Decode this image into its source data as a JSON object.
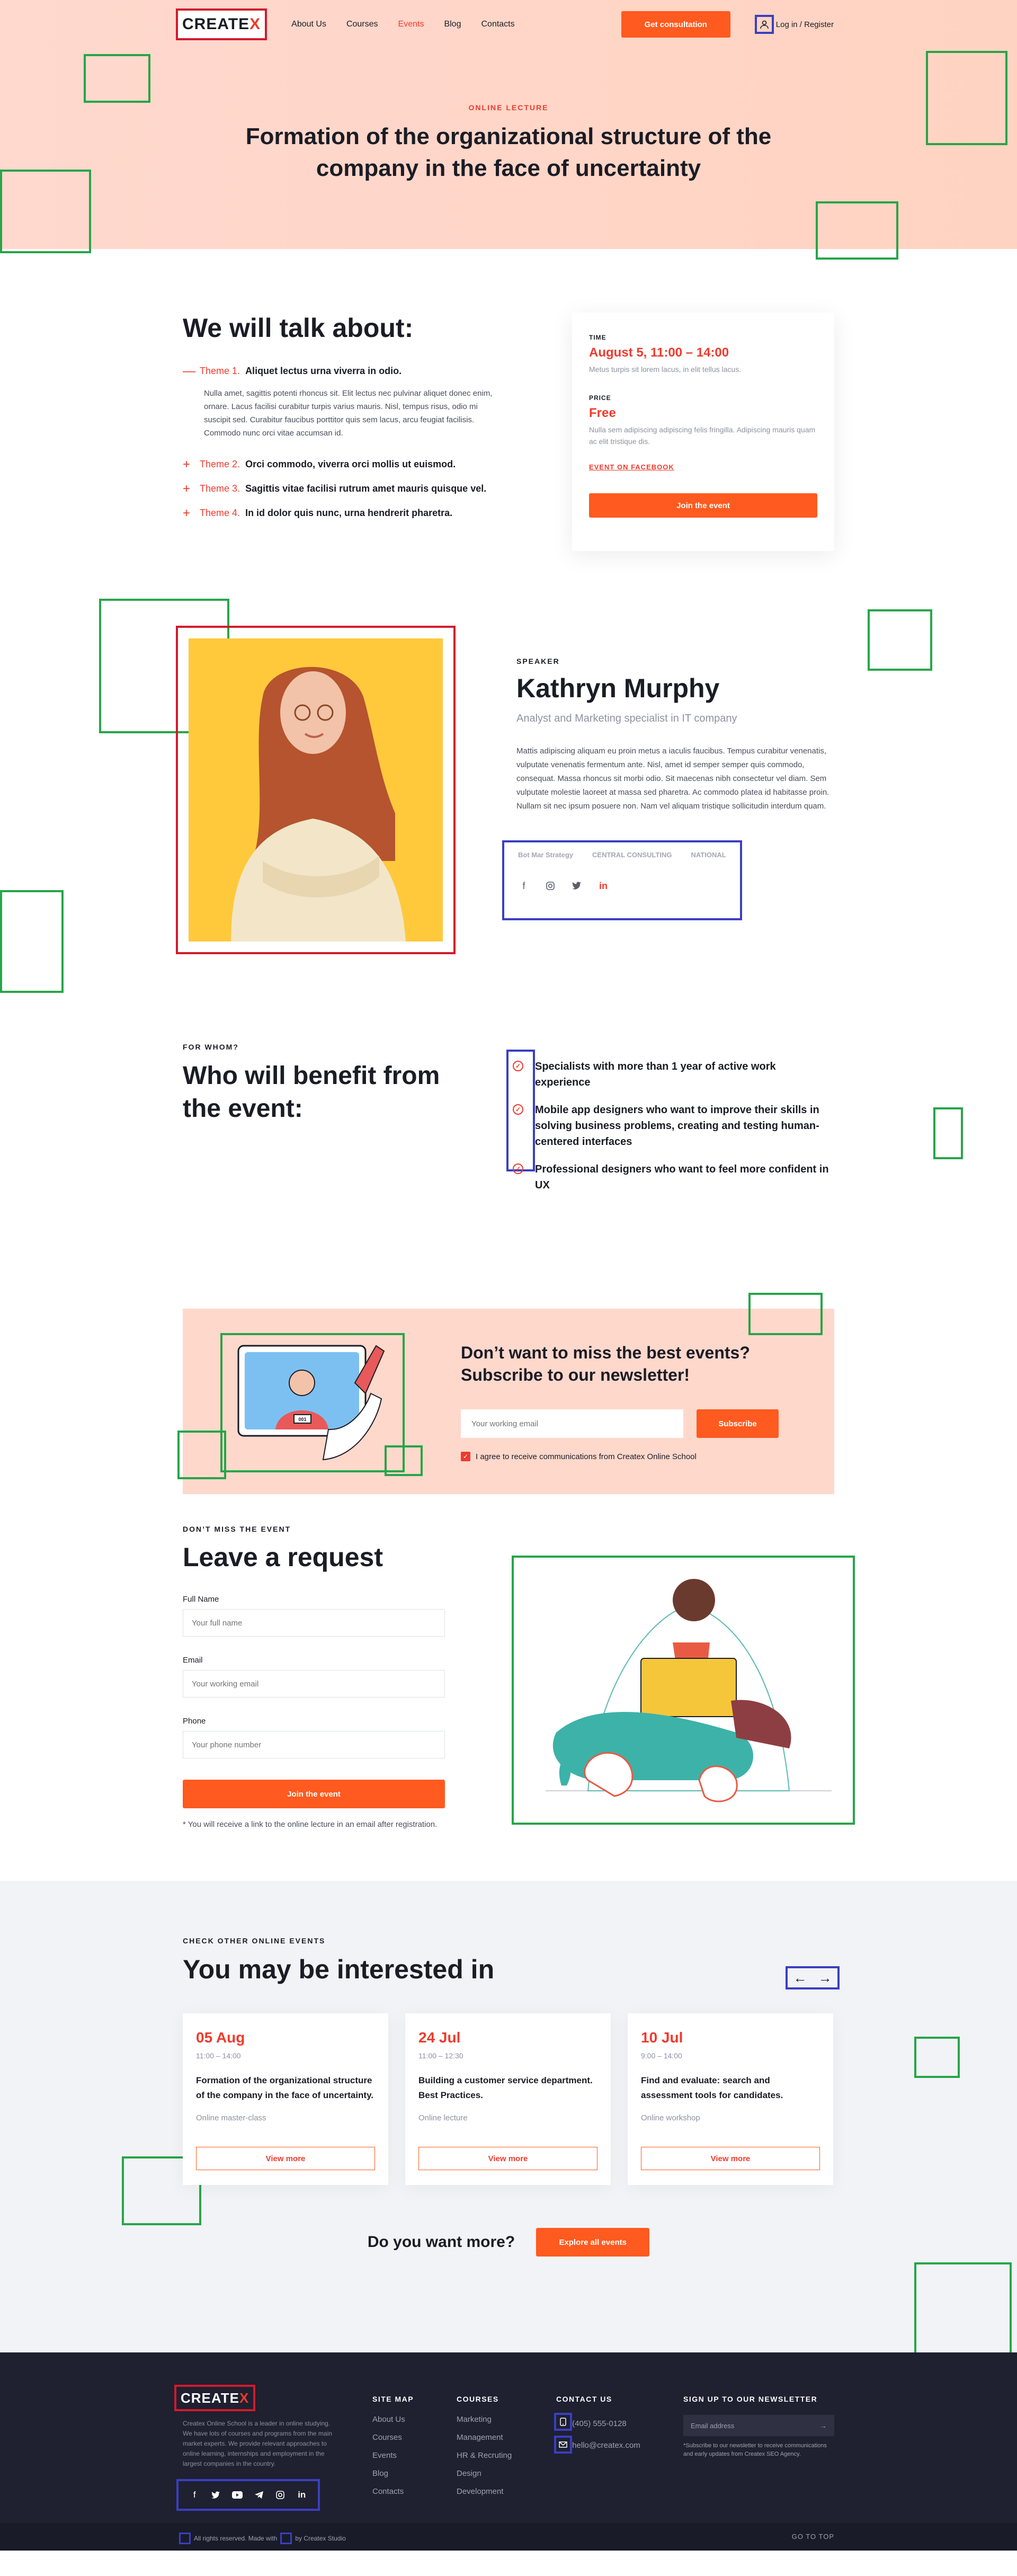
{
  "brand": {
    "logo_main": "CREATE",
    "logo_x": "X"
  },
  "nav": {
    "items": [
      "About Us",
      "Courses",
      "Events",
      "Blog",
      "Contacts"
    ],
    "active_item": "Events",
    "cta": "Get consultation",
    "login": "Log in / Register"
  },
  "hero": {
    "kicker": "ONLINE LECTURE",
    "title": "Formation of the organizational structure of the company in the face of uncertainty"
  },
  "talk": {
    "heading": "We will talk about:",
    "themes": [
      {
        "num": "Theme 1.",
        "title": "Aliquet lectus urna viverra in odio.",
        "expanded": true,
        "desc": "Nulla amet, sagittis potenti rhoncus sit. Elit lectus nec pulvinar aliquet donec enim, ornare. Lacus facilisi curabitur turpis varius mauris. Nisl, tempus risus, odio mi suscipit sed. Curabitur faucibus porttitor quis sem lacus, arcu feugiat facilisis. Commodo nunc orci vitae accumsan id."
      },
      {
        "num": "Theme 2.",
        "title": "Orci commodo, viverra orci mollis ut euismod.",
        "expanded": false
      },
      {
        "num": "Theme 3.",
        "title": "Sagittis vitae facilisi rutrum amet mauris quisque vel.",
        "expanded": false
      },
      {
        "num": "Theme 4.",
        "title": "In id dolor quis nunc, urna hendrerit pharetra.",
        "expanded": false
      }
    ],
    "card": {
      "time_label": "TIME",
      "time_value": "August 5, 11:00 – 14:00",
      "time_note": "Metus turpis sit lorem lacus, in elit tellus lacus.",
      "price_label": "PRICE",
      "price_value": "Free",
      "price_note": "Nulla sem adipiscing adipiscing felis fringilla. Adipiscing mauris quam ac elit tristique dis.",
      "link": "EVENT ON FACEBOOK",
      "button": "Join the event"
    }
  },
  "speaker": {
    "kicker": "SPEAKER",
    "name": "Kathryn Murphy",
    "role": "Analyst and Marketing specialist in IT company",
    "bio": "Mattis adipiscing aliquam eu proin metus a iaculis faucibus. Tempus curabitur venenatis, vulputate venenatis fermentum ante. Nisl, amet id semper semper quis commodo, consequat. Massa rhoncus sit morbi odio. Sit maecenas nibh consectetur vel diam. Sem vulputate molestie laoreet at massa sed pharetra. Ac commodo platea id habitasse proin. Nullam sit nec ipsum posuere non. Nam vel aliquam tristique sollicitudin interdum quam.",
    "partners": [
      "Bot Mar Strategy",
      "CENTRAL CONSULTING",
      "NATIONAL"
    ],
    "socials": [
      "facebook-icon",
      "instagram-icon",
      "twitter-icon",
      "linkedin-icon"
    ],
    "active_social": "linkedin-icon"
  },
  "benefit": {
    "kicker": "FOR WHOM?",
    "title": "Who will benefit from the event:",
    "items": [
      "Specialists with more than 1 year of active work experience",
      "Mobile app designers who want to improve their skills in solving business problems, creating and testing human-centered interfaces",
      "Professional designers who want to feel more confident in UX"
    ]
  },
  "newsletter": {
    "title": "Don’t want to miss the best events? Subscribe to our newsletter!",
    "placeholder": "Your working email",
    "button": "Subscribe",
    "agree": "I agree to receive communications from Createx Online School",
    "screen_badge": "001"
  },
  "request": {
    "kicker": "DON’T MISS THE EVENT",
    "title": "Leave a request",
    "fields": [
      {
        "label": "Full Name",
        "placeholder": "Your full name"
      },
      {
        "label": "Email",
        "placeholder": "Your working email"
      },
      {
        "label": "Phone",
        "placeholder": "Your phone number"
      }
    ],
    "button": "Join the event",
    "note": "* You will receive a link to the online lecture in an email after registration."
  },
  "events": {
    "kicker": "CHECK OTHER ONLINE EVENTS",
    "title": "You may be interested in",
    "cards": [
      {
        "date": "05 Aug",
        "time": "11:00 – 14:00",
        "title": "Formation of the organizational structure of the company in the face of uncertainty.",
        "type": "Online master-class",
        "button": "View more"
      },
      {
        "date": "24 Jul",
        "time": "11:00 – 12:30",
        "title": "Building a customer service department. Best Practices.",
        "type": "Online lecture",
        "button": "View more"
      },
      {
        "date": "10 Jul",
        "time": "9:00 – 14:00",
        "title": "Find and evaluate: search and assessment tools for candidates.",
        "type": "Online workshop",
        "button": "View more"
      }
    ],
    "more_question": "Do you want more?",
    "more_button": "Explore all events"
  },
  "footer": {
    "about": "Createx Online School is a leader in online studying. We have lots of courses and programs from the main market experts. We provide relevant approaches to online learning, internships and employment in the largest companies in the country.",
    "socials": [
      "facebook-icon",
      "twitter-icon",
      "youtube-icon",
      "telegram-icon",
      "instagram-icon",
      "linkedin-icon"
    ],
    "sitemap_title": "SITE MAP",
    "sitemap": [
      "About Us",
      "Courses",
      "Events",
      "Blog",
      "Contacts"
    ],
    "courses_title": "COURSES",
    "courses": [
      "Marketing",
      "Management",
      "HR & Recruting",
      "Design",
      "Development"
    ],
    "contact_title": "CONTACT US",
    "phone": "(405) 555-0128",
    "email": "hello@createx.com",
    "newsletter_title": "SIGN UP TO OUR NEWSLETTER",
    "newsletter_placeholder": "Email address",
    "newsletter_note": "*Subscribe to our newsletter to receive communications and early updates from Createx SEO Agency.",
    "copyright_a": "All rights reserved. Made with",
    "copyright_b": "by Createx Studio",
    "to_top": "GO TO TOP"
  },
  "colors": {
    "accent": "#ff5a1f",
    "accent_text": "#ef3b2d",
    "hero_bg": "#ffd8ce",
    "footer_bg": "#1f2030",
    "dark_text": "#1b1c25"
  }
}
